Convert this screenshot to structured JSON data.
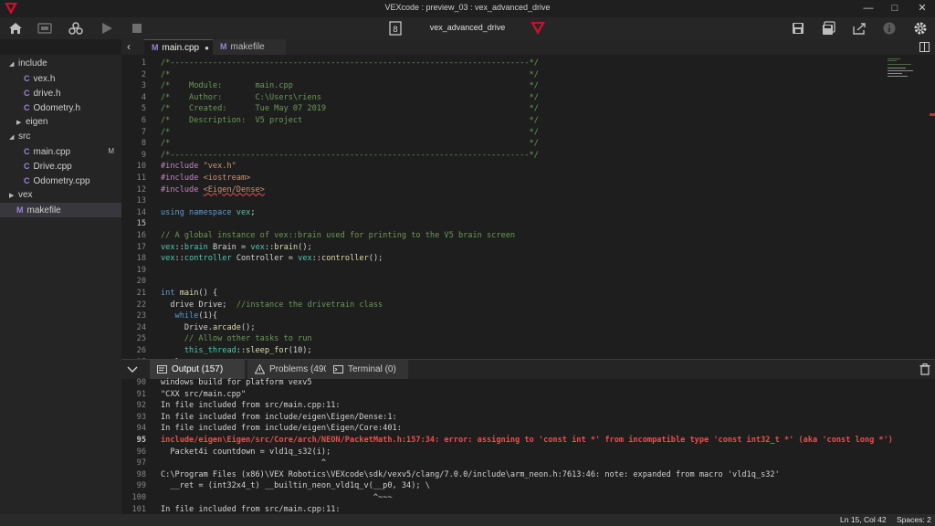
{
  "window": {
    "title": "VEXcode : preview_03 : vex_advanced_drive",
    "minimize": "—",
    "maximize": "□",
    "close": "✕"
  },
  "toolbar": {
    "project_name": "vex_advanced_drive",
    "slot": "8",
    "icons": [
      "home-icon",
      "device-icon",
      "build-icon",
      "run-icon",
      "stop-icon",
      "slot-icon",
      "vex-logo-icon",
      "save-icon",
      "save-as-icon",
      "share-icon",
      "info-icon",
      "settings-icon"
    ],
    "accent": "#c8102e"
  },
  "editor_tabs": [
    {
      "label": "main.cpp",
      "icon": "file-icon",
      "modified": true
    },
    {
      "label": "makefile",
      "icon": "makefile-icon",
      "modified": false
    }
  ],
  "sidebar": {
    "items": [
      {
        "label": "include",
        "type": "folder",
        "expanded": true
      },
      {
        "label": "vex.h",
        "type": "file"
      },
      {
        "label": "drive.h",
        "type": "file"
      },
      {
        "label": "Odometry.h",
        "type": "file"
      },
      {
        "label": "eigen",
        "type": "folder",
        "expanded": false
      },
      {
        "label": "src",
        "type": "folder",
        "expanded": true
      },
      {
        "label": "main.cpp",
        "type": "file",
        "badge": "M"
      },
      {
        "label": "Drive.cpp",
        "type": "file"
      },
      {
        "label": "Odometry.cpp",
        "type": "file"
      },
      {
        "label": "vex",
        "type": "folder",
        "expanded": false
      },
      {
        "label": "makefile",
        "type": "makefile",
        "selected": true
      }
    ]
  },
  "code": {
    "current_line": 15,
    "lines": [
      {
        "n": "1",
        "text": "/*----------------------------------------------------------------------------*/"
      },
      {
        "n": "2",
        "text": "/*                                                                            */"
      },
      {
        "n": "3",
        "text": "/*    Module:       main.cpp                                                  */"
      },
      {
        "n": "4",
        "text": "/*    Author:       C:\\Users\\riens                                            */"
      },
      {
        "n": "5",
        "text": "/*    Created:      Tue May 07 2019                                           */"
      },
      {
        "n": "6",
        "text": "/*    Description:  V5 project                                                */"
      },
      {
        "n": "7",
        "text": "/*                                                                            */"
      },
      {
        "n": "8",
        "text": "/*                                                                            */"
      },
      {
        "n": "9",
        "text": "/*----------------------------------------------------------------------------*/"
      },
      {
        "n": "10",
        "pp": "#include ",
        "str": "\"vex.h\""
      },
      {
        "n": "11",
        "pp": "#include ",
        "str": "<iostream>"
      },
      {
        "n": "12",
        "pp": "#include ",
        "err": "<Eigen/Dense>"
      },
      {
        "n": "13",
        "text": ""
      },
      {
        "n": "14",
        "kw": "using namespace ",
        "ns": "vex",
        "rest": ";"
      },
      {
        "n": "15",
        "text": ""
      },
      {
        "n": "16",
        "text": "// A global instance of vex::brain used for printing to the V5 brain screen"
      },
      {
        "n": "17",
        "code": "vex::brain Brain = vex::brain();"
      },
      {
        "n": "18",
        "code": "vex::controller Controller = vex::controller();"
      },
      {
        "n": "19",
        "text": ""
      },
      {
        "n": "20",
        "text": ""
      },
      {
        "n": "21",
        "code": "int main() {"
      },
      {
        "n": "22",
        "code": "  drive Drive;  ",
        "comment": "//instance the drivetrain class"
      },
      {
        "n": "23",
        "code": "   while(1){"
      },
      {
        "n": "24",
        "code": "     Drive.arcade();"
      },
      {
        "n": "25",
        "code": "     ",
        "comment": "// Allow other tasks to run"
      },
      {
        "n": "26",
        "code": "     this_thread::sleep_for(10);"
      },
      {
        "n": "27",
        "code": "   }"
      }
    ]
  },
  "panel": {
    "tabs": [
      {
        "label": "Output (157)",
        "icon": "output-icon"
      },
      {
        "label": "Problems (490)",
        "icon": "problems-icon"
      },
      {
        "label": "Terminal (0)",
        "icon": "terminal-icon"
      }
    ],
    "current_line": 95,
    "lines": [
      {
        "n": "90",
        "text": "windows build for platform vexv5"
      },
      {
        "n": "91",
        "text": "\"CXX src/main.cpp\""
      },
      {
        "n": "92",
        "text": "In file included from src/main.cpp:11:"
      },
      {
        "n": "93",
        "text": "In file included from include/eigen\\Eigen/Dense:1:"
      },
      {
        "n": "94",
        "text": "In file included from include/eigen\\Eigen/Core:401:"
      },
      {
        "n": "95",
        "text": "include/eigen\\Eigen/src/Core/arch/NEON/PacketMath.h:157:34: error: assigning to 'const int *' from incompatible type 'const int32_t *' (aka 'const long *')",
        "error": true
      },
      {
        "n": "96",
        "text": "  Packet4i countdown = vld1q_s32(i);"
      },
      {
        "n": "97",
        "text": "                                  ^"
      },
      {
        "n": "98",
        "text": "C:\\Program Files (x86)\\VEX Robotics\\VEXcode\\sdk/vexv5/clang/7.0.0/include\\arm_neon.h:7613:46: note: expanded from macro 'vld1q_s32'"
      },
      {
        "n": "99",
        "text": "  __ret = (int32x4_t) __builtin_neon_vld1q_v(__p0, 34); \\"
      },
      {
        "n": "100",
        "text": "                                             ^~~~"
      },
      {
        "n": "101",
        "text": "In file included from src/main.cpp:11:"
      }
    ]
  },
  "statusbar": {
    "position": "Ln 15, Col 42",
    "spaces": "Spaces: 2"
  }
}
